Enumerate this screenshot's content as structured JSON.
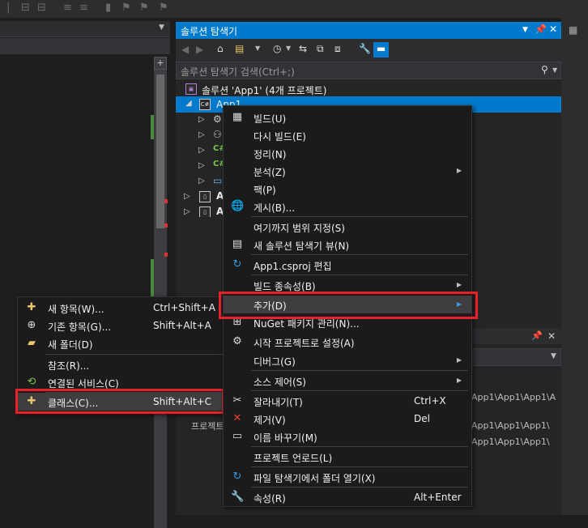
{
  "solution_explorer": {
    "title": "솔루션 탐색기",
    "search_placeholder": "솔루션 탐색기 검색(Ctrl+;)",
    "solution_label": "솔루션 'App1' (4개 프로젝트)",
    "project_label": "App1",
    "node_a1": "A",
    "node_a2": "A",
    "node_a3": "A"
  },
  "background_paths": {
    "path1": "App1\\App1\\App1\\A",
    "path2": "App1\\App1\\App1\\",
    "path3": "App1\\App1\\App1\\",
    "project_fragment": "프로젝트"
  },
  "context_menu": {
    "items": [
      {
        "label": "빌드(U)",
        "icon": "build-icon"
      },
      {
        "label": "다시 빌드(E)"
      },
      {
        "label": "정리(N)"
      },
      {
        "label": "분석(Z)",
        "submenu": true
      },
      {
        "label": "팩(P)"
      },
      {
        "label": "게시(B)...",
        "icon": "globe-icon"
      },
      {
        "label": "여기까지 범위 지정(S)"
      },
      {
        "label": "새 솔루션 탐색기 뷰(N)",
        "icon": "new-view-icon"
      },
      {
        "label": "App1.csproj 편집",
        "icon": "refresh-icon"
      },
      {
        "label": "빌드 종속성(B)",
        "submenu": true
      },
      {
        "label": "추가(D)",
        "submenu": true,
        "highlighted": true
      },
      {
        "label": "NuGet 패키지 관리(N)...",
        "icon": "nuget-icon"
      },
      {
        "label": "시작 프로젝트로 설정(A)",
        "icon": "gear-icon"
      },
      {
        "label": "디버그(G)",
        "submenu": true
      },
      {
        "label": "소스 제어(S)",
        "submenu": true
      },
      {
        "label": "잘라내기(T)",
        "shortcut": "Ctrl+X",
        "icon": "scissors-icon"
      },
      {
        "label": "제거(V)",
        "shortcut": "Del",
        "icon": "delete-icon"
      },
      {
        "label": "이름 바꾸기(M)",
        "icon": "rename-icon"
      },
      {
        "label": "프로젝트 언로드(L)"
      },
      {
        "label": "파일 탐색기에서 폴더 열기(X)",
        "icon": "folder-refresh-icon"
      },
      {
        "label": "속성(R)",
        "shortcut": "Alt+Enter",
        "icon": "wrench-icon"
      }
    ]
  },
  "add_submenu": {
    "items": [
      {
        "label": "새 항목(W)...",
        "shortcut": "Ctrl+Shift+A",
        "icon": "new-item-icon"
      },
      {
        "label": "기존 항목(G)...",
        "shortcut": "Shift+Alt+A",
        "icon": "existing-item-icon"
      },
      {
        "label": "새 폴더(D)",
        "icon": "new-folder-icon"
      },
      {
        "label": "참조(R)..."
      },
      {
        "label": "연결된 서비스(C)",
        "icon": "connected-service-icon"
      },
      {
        "label": "클래스(C)...",
        "shortcut": "Shift+Alt+C",
        "icon": "class-icon",
        "highlighted": true
      }
    ]
  },
  "colors": {
    "accent": "#007acc",
    "callout_red": "#e8202a",
    "menu_bg": "#1b1b1c",
    "menu_highlight": "#3e3e40"
  }
}
